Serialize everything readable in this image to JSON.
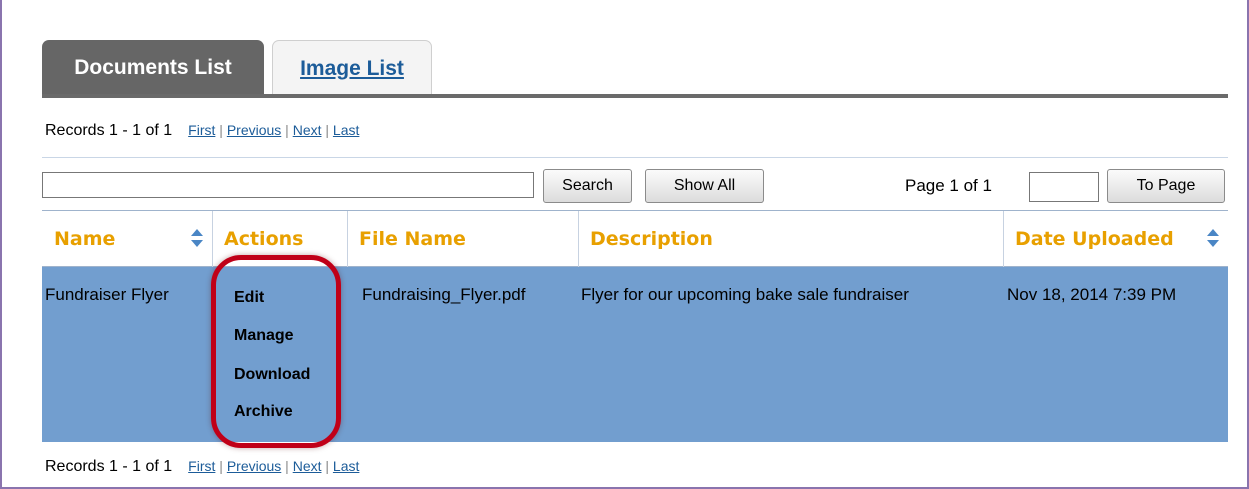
{
  "tabs": [
    {
      "label": "Documents List",
      "active": true
    },
    {
      "label": "Image List",
      "active": false
    }
  ],
  "records": {
    "text": "Records 1 - 1 of 1",
    "first": "First",
    "previous": "Previous",
    "next": "Next",
    "last": "Last",
    "separator": "|"
  },
  "search": {
    "value": "",
    "search_button": "Search",
    "show_all_button": "Show All"
  },
  "paging": {
    "label": "Page 1 of 1",
    "page_value": "",
    "to_page_button": "To Page"
  },
  "table": {
    "columns": [
      "Name",
      "Actions",
      "File Name",
      "Description",
      "Date Uploaded"
    ],
    "rows": [
      {
        "name": "Fundraiser Flyer",
        "actions": [
          "Edit",
          "Manage",
          "Download",
          "Archive"
        ],
        "file_name": "Fundraising_Flyer.pdf",
        "description": "Flyer for our upcoming bake sale fundraiser",
        "date_uploaded": "Nov 18, 2014 7:39 PM"
      }
    ]
  },
  "colors": {
    "active_tab": "#666666",
    "header_text": "#e8a000",
    "selected_row": "#729ecf",
    "link": "#1c5c99",
    "highlight_ring": "#c00018",
    "frame": "#8a74ae"
  },
  "icons": {
    "sort": "sort-arrows-icon"
  }
}
